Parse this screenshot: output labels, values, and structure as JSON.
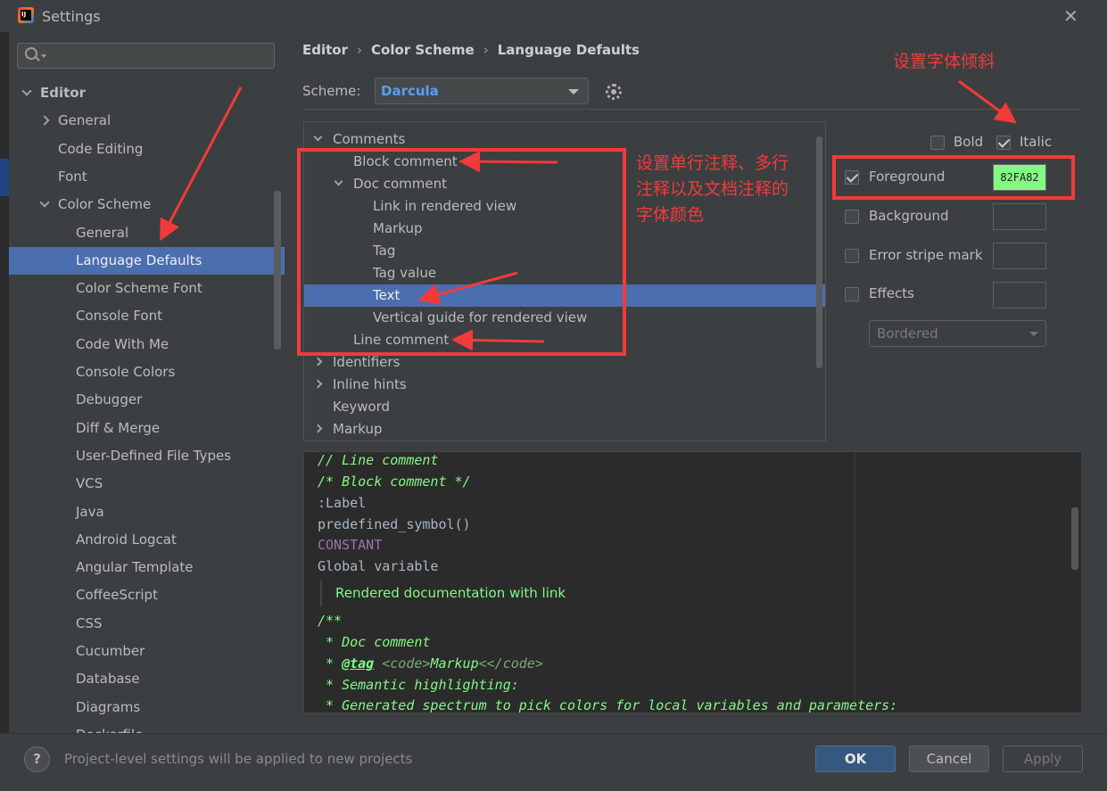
{
  "window": {
    "title": "Settings"
  },
  "search": {
    "value": "",
    "placeholder": ""
  },
  "sidebar": {
    "items": [
      {
        "label": "Editor",
        "level": 0,
        "arrow": "open",
        "bold": true
      },
      {
        "label": "General",
        "level": 1,
        "arrow": "closed"
      },
      {
        "label": "Code Editing",
        "level": 1
      },
      {
        "label": "Font",
        "level": 1
      },
      {
        "label": "Color Scheme",
        "level": 1,
        "arrow": "open"
      },
      {
        "label": "General",
        "level": 2
      },
      {
        "label": "Language Defaults",
        "level": 2,
        "selected": true
      },
      {
        "label": "Color Scheme Font",
        "level": 2
      },
      {
        "label": "Console Font",
        "level": 2
      },
      {
        "label": "Code With Me",
        "level": 2
      },
      {
        "label": "Console Colors",
        "level": 2
      },
      {
        "label": "Debugger",
        "level": 2
      },
      {
        "label": "Diff & Merge",
        "level": 2
      },
      {
        "label": "User-Defined File Types",
        "level": 2
      },
      {
        "label": "VCS",
        "level": 2
      },
      {
        "label": "Java",
        "level": 2
      },
      {
        "label": "Android Logcat",
        "level": 2
      },
      {
        "label": "Angular Template",
        "level": 2
      },
      {
        "label": "CoffeeScript",
        "level": 2
      },
      {
        "label": "CSS",
        "level": 2
      },
      {
        "label": "Cucumber",
        "level": 2
      },
      {
        "label": "Database",
        "level": 2
      },
      {
        "label": "Diagrams",
        "level": 2
      },
      {
        "label": "Dockerfile",
        "level": 2
      }
    ]
  },
  "breadcrumb": [
    "Editor",
    "Color Scheme",
    "Language Defaults"
  ],
  "scheme": {
    "label": "Scheme:",
    "value": "Darcula"
  },
  "attributes": {
    "items": [
      {
        "label": "Comments",
        "level": 0,
        "arrow": "open"
      },
      {
        "label": "Block comment",
        "level": 1
      },
      {
        "label": "Doc comment",
        "level": 1,
        "arrow": "open"
      },
      {
        "label": "Link in rendered view",
        "level": 2
      },
      {
        "label": "Markup",
        "level": 2
      },
      {
        "label": "Tag",
        "level": 2
      },
      {
        "label": "Tag value",
        "level": 2
      },
      {
        "label": "Text",
        "level": 2,
        "selected": true
      },
      {
        "label": "Vertical guide for rendered view",
        "level": 2
      },
      {
        "label": "Line comment",
        "level": 1
      },
      {
        "label": "Identifiers",
        "level": 0,
        "arrow": "closed"
      },
      {
        "label": "Inline hints",
        "level": 0,
        "arrow": "closed"
      },
      {
        "label": "Keyword",
        "level": 0
      },
      {
        "label": "Markup",
        "level": 0,
        "arrow": "closed"
      }
    ]
  },
  "options": {
    "bold_label": "Bold",
    "bold_checked": false,
    "italic_label": "Italic",
    "italic_checked": true,
    "foreground_label": "Foreground",
    "foreground_checked": true,
    "foreground_value": "82FA82",
    "background_label": "Background",
    "error_stripe_label": "Error stripe mark",
    "effects_label": "Effects",
    "effects_value": "Bordered"
  },
  "preview": {
    "line_comment": "// Line comment",
    "block_comment": "/* Block comment */",
    "label": ":Label",
    "predefined": "predefined_symbol()",
    "constant": "CONSTANT",
    "global": "Global variable",
    "rendered_doc": "Rendered documentation with link",
    "doc_open": "/**",
    "doc_comment": " * Doc comment",
    "tag_prefix": " * ",
    "tag": "@tag",
    "tag_html_open": " <code>",
    "tag_markup": "Markup",
    "tag_html_close": "<</code>",
    "semantic": " * Semantic highlighting:",
    "generated": " * Generated spectrum to pick colors for local variables and parameters:"
  },
  "footer": {
    "help": "?",
    "note": "Project-level settings will be applied to new projects",
    "ok": "OK",
    "cancel": "Cancel",
    "apply": "Apply"
  },
  "annotations": {
    "italic_note": "设置字体倾斜",
    "comment_note_1": "设置单行注释、多行",
    "comment_note_2": "注释以及文档注释的",
    "comment_note_3": "字体颜色"
  },
  "colors": {
    "accent_selection": "#4b6eaf",
    "scheme_value": "#589df6",
    "foreground_swatch": "#82fa82",
    "annotation_red": "#f23a3a"
  }
}
